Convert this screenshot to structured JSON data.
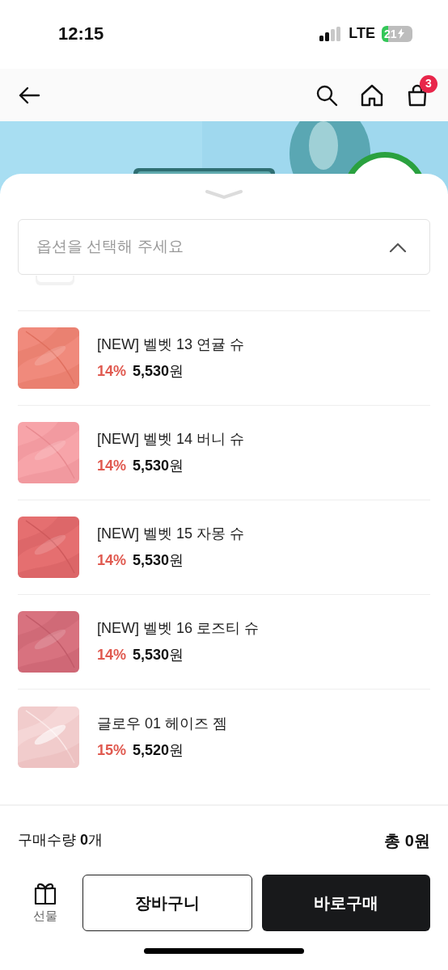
{
  "status_bar": {
    "time": "12:15",
    "network": "LTE",
    "battery": "21"
  },
  "nav": {
    "cart_count": "3"
  },
  "option_select": {
    "placeholder": "옵션을 선택해 주세요",
    "expanded": true
  },
  "options": [
    {
      "name": "[NEW] 벨벳 13 연귤 슈",
      "discount": "14%",
      "price": "**5,530**원"
    },
    {
      "name": "[NEW] 벨벳 14 버니 슈",
      "discount": "14%",
      "price": "**5,530**원"
    },
    {
      "name": "[NEW] 벨벳 15 자몽 슈",
      "discount": "14%",
      "price": "**5,530**원"
    },
    {
      "name": "[NEW] 벨벳 16 로즈티 슈",
      "discount": "14%",
      "price": "**5,530**원"
    },
    {
      "name": "글로우 01 헤이즈 젬",
      "discount": "15%",
      "price": "**5,520**원"
    }
  ],
  "summary": {
    "quantity": "구매수량 **0**개",
    "total": "총 0원"
  },
  "actions": {
    "gift": "선물",
    "cart": "장바구니",
    "buy": "바로구매"
  }
}
